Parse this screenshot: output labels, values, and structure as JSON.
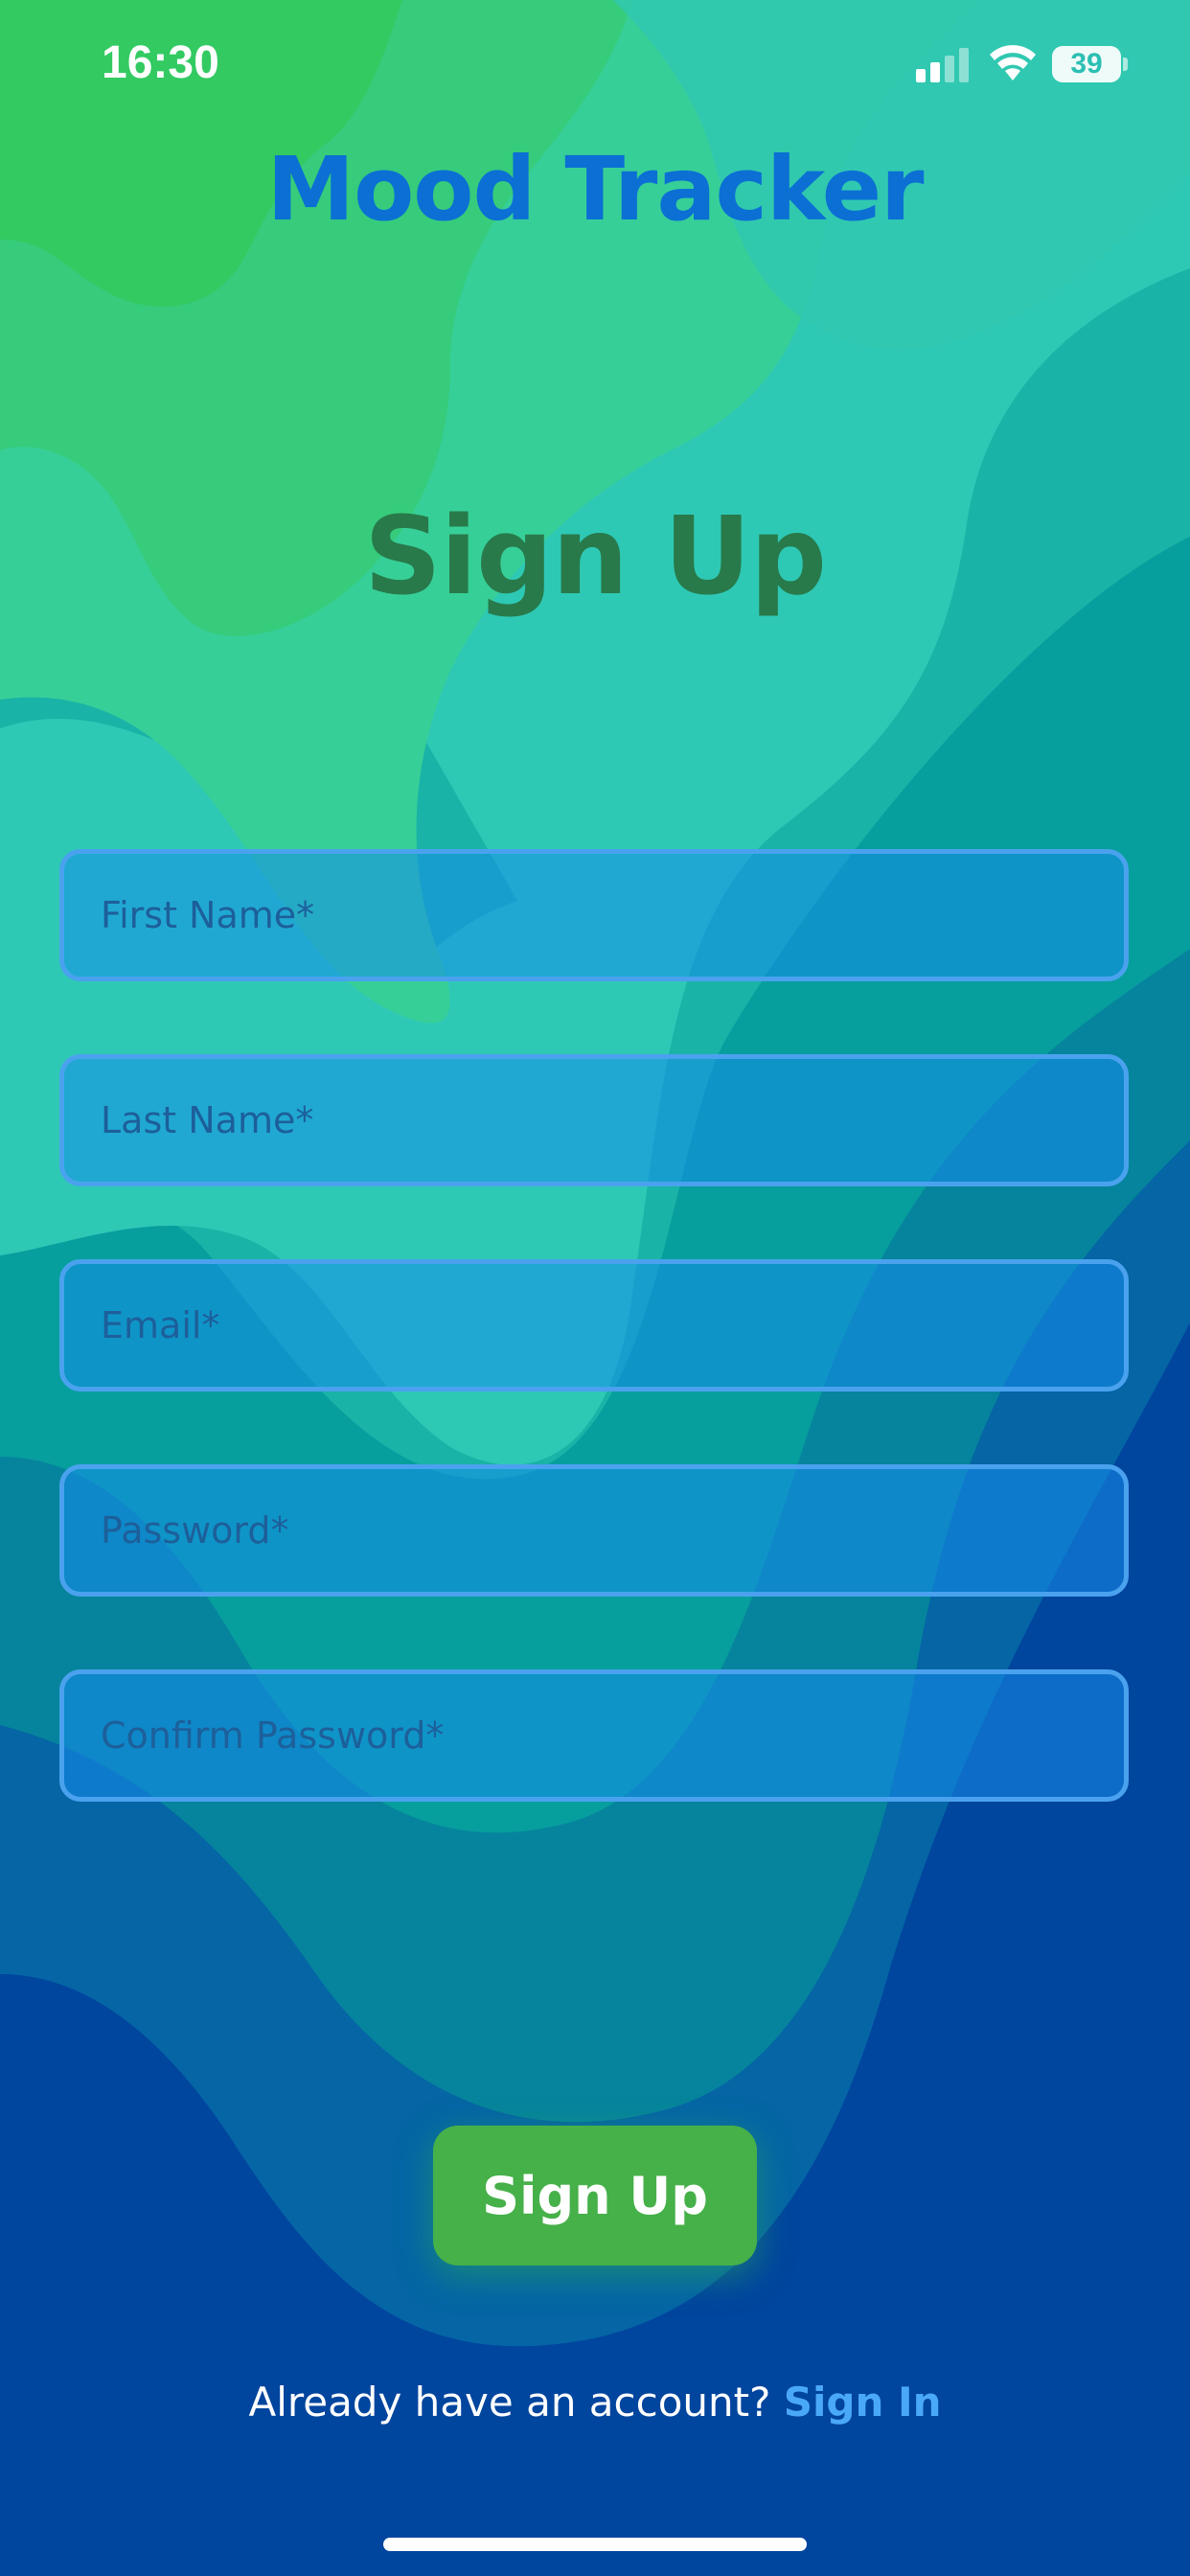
{
  "status_bar": {
    "time": "16:30",
    "battery_level": "39",
    "signal_icon": "cellular-signal-icon",
    "wifi_icon": "wifi-icon",
    "battery_icon": "battery-icon"
  },
  "app": {
    "title": "Mood Tracker"
  },
  "page": {
    "title": "Sign Up"
  },
  "form": {
    "first_name": {
      "placeholder": "First Name*",
      "value": ""
    },
    "last_name": {
      "placeholder": "Last Name*",
      "value": ""
    },
    "email": {
      "placeholder": "Email*",
      "value": ""
    },
    "password": {
      "placeholder": "Password*",
      "value": ""
    },
    "confirm_password": {
      "placeholder": "Confirm Password*",
      "value": ""
    },
    "submit_label": "Sign Up"
  },
  "footer": {
    "prompt": "Already have an account?",
    "link_label": "Sign In"
  },
  "colors": {
    "title_blue": "#0b6fd4",
    "heading_green": "#287a4a",
    "field_border": "#4aa2ee",
    "button_green": "#46b049",
    "link_blue": "#4aa8f8",
    "bg_dark_blue": "#00459e"
  }
}
